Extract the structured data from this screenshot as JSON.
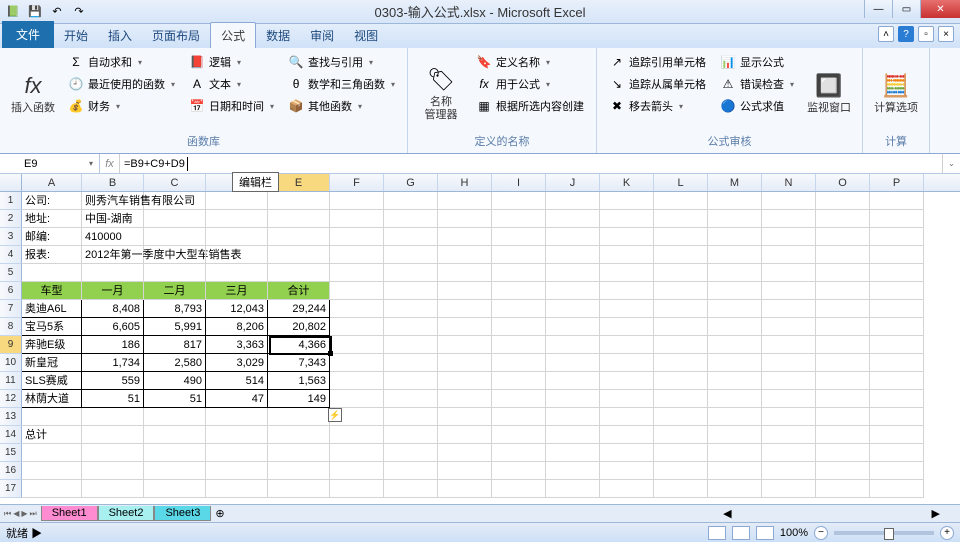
{
  "title": "0303-输入公式.xlsx - Microsoft Excel",
  "tabs": {
    "file": "文件",
    "home": "开始",
    "insert": "插入",
    "layout": "页面布局",
    "formulas": "公式",
    "data": "数据",
    "review": "审阅",
    "view": "视图"
  },
  "ribbon": {
    "g1_title": "函数库",
    "g2_title": "定义的名称",
    "g3_title": "公式审核",
    "g4_title": "计算",
    "insert_fn": "插入函数",
    "autosum": "自动求和",
    "recent": "最近使用的函数",
    "financial": "财务",
    "logical": "逻辑",
    "text": "文本",
    "datetime": "日期和时间",
    "lookup": "查找与引用",
    "math": "数学和三角函数",
    "more": "其他函数",
    "name_mgr": "名称\n管理器",
    "define_name": "定义名称",
    "use_formula": "用于公式",
    "create_sel": "根据所选内容创建",
    "trace_prec": "追踪引用单元格",
    "trace_dep": "追踪从属单元格",
    "remove_arrow": "移去箭头",
    "show_formula": "显示公式",
    "error_check": "错误检查",
    "eval_formula": "公式求值",
    "watch": "监视窗口",
    "calc_opts": "计算选项"
  },
  "name_box": "E9",
  "formula": "=B9+C9+D9",
  "fb_callout": "编辑栏",
  "cols": [
    "A",
    "B",
    "C",
    "D",
    "E",
    "F",
    "G",
    "H",
    "I",
    "J",
    "K",
    "L",
    "M",
    "N",
    "O",
    "P"
  ],
  "info": {
    "r1a": "公司:",
    "r1b": "则秀汽车销售有限公司",
    "r2a": "地址:",
    "r2b": "中国-湖南",
    "r3a": "邮编:",
    "r3b": "410000",
    "r4a": "报表:",
    "r4b": "2012年第一季度中大型车销售表"
  },
  "headers": [
    "车型",
    "一月",
    "二月",
    "三月",
    "合计"
  ],
  "rows_data": [
    {
      "n": "奥迪A6L",
      "v": [
        "8,408",
        "8,793",
        "12,043",
        "29,244"
      ]
    },
    {
      "n": "宝马5系",
      "v": [
        "6,605",
        "5,991",
        "8,206",
        "20,802"
      ]
    },
    {
      "n": "奔驰E级",
      "v": [
        "186",
        "817",
        "3,363",
        "4,366"
      ]
    },
    {
      "n": "新皇冠",
      "v": [
        "1,734",
        "2,580",
        "3,029",
        "7,343"
      ]
    },
    {
      "n": "SLS赛威",
      "v": [
        "559",
        "490",
        "514",
        "1,563"
      ]
    },
    {
      "n": "林荫大道",
      "v": [
        "51",
        "51",
        "47",
        "149"
      ]
    }
  ],
  "total_label": "总计",
  "sheets": [
    "Sheet1",
    "Sheet2",
    "Sheet3"
  ],
  "status": "就绪",
  "zoom": "100%",
  "chart_data": {
    "type": "table",
    "title": "2012年第一季度中大型车销售表",
    "columns": [
      "车型",
      "一月",
      "二月",
      "三月",
      "合计"
    ],
    "rows": [
      [
        "奥迪A6L",
        8408,
        8793,
        12043,
        29244
      ],
      [
        "宝马5系",
        6605,
        5991,
        8206,
        20802
      ],
      [
        "奔驰E级",
        186,
        817,
        3363,
        4366
      ],
      [
        "新皇冠",
        1734,
        2580,
        3029,
        7343
      ],
      [
        "SLS赛威",
        559,
        490,
        514,
        1563
      ],
      [
        "林荫大道",
        51,
        51,
        47,
        149
      ]
    ]
  }
}
